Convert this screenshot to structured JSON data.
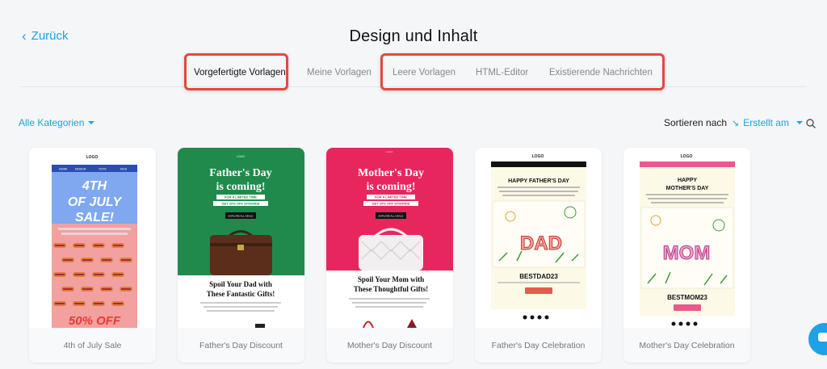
{
  "header": {
    "back_label": "Zurück",
    "title": "Design und Inhalt"
  },
  "tabs": [
    {
      "label": "Vorgefertigte Vorlagen",
      "active": true
    },
    {
      "label": "Meine Vorlagen",
      "active": false
    },
    {
      "label": "Leere Vorlagen",
      "active": false
    },
    {
      "label": "HTML-Editor",
      "active": false
    },
    {
      "label": "Existierende Nachrichten",
      "active": false
    }
  ],
  "filters": {
    "categories_label": "Alle Kategorien",
    "sort_label": "Sortieren nach",
    "sort_value": "Erstellt am"
  },
  "templates": [
    {
      "name": "4th of July Sale",
      "logo": "LOGO",
      "nav": [
        "HOME",
        "DESIGN",
        "TOYS",
        "KIDS"
      ],
      "headline": [
        "4TH",
        "OF JULY",
        "SALE!"
      ],
      "footer_text": "50% OFF"
    },
    {
      "name": "Father's Day Discount",
      "logo": "LOGO",
      "headline": [
        "Father's Day",
        "is coming!"
      ],
      "offer": [
        "FOR A LIMITED TIME",
        "GET 20% OFF SITEWIDE"
      ],
      "button": "EXPLORE ALL DEALS",
      "subhead": [
        "Spoil Your Dad with",
        "These Fantastic Gifts!"
      ]
    },
    {
      "name": "Mother's Day Discount",
      "logo": "LOGO",
      "headline": [
        "Mother's Day",
        "is coming!"
      ],
      "offer": [
        "FOR A LIMITED TIME",
        "GET 20% OFF SITEWIDE"
      ],
      "button": "EXPLORE ALL DEALS",
      "subhead": [
        "Spoil Your Mom with",
        "These Thoughtful Gifts!"
      ]
    },
    {
      "name": "Father's Day Celebration",
      "logo": "LOGO",
      "heading": "HAPPY FATHER'S DAY",
      "drawing_word": "DAD",
      "code": "BESTDAD23"
    },
    {
      "name": "Mother's Day Celebration",
      "logo": "LOGO",
      "heading": [
        "HAPPY",
        "MOTHER'S DAY"
      ],
      "drawing_word": "MOM",
      "code": "BESTMOM23"
    }
  ],
  "colors": {
    "accent": "#1ea1e6",
    "highlight": "#e04a3f",
    "fathers_green": "#1f8a4c",
    "mothers_pink": "#e8265e",
    "july_sky": "#7fa8f0",
    "july_pink": "#f2a0a0",
    "july_nav": "#2b4cb3",
    "celebration_bg": "#fdf9e7",
    "mom_nav": "#e85a8c"
  },
  "icons": [
    "chevron-left-icon",
    "caret-down-icon",
    "sort-icon",
    "search-icon",
    "chat-icon"
  ]
}
